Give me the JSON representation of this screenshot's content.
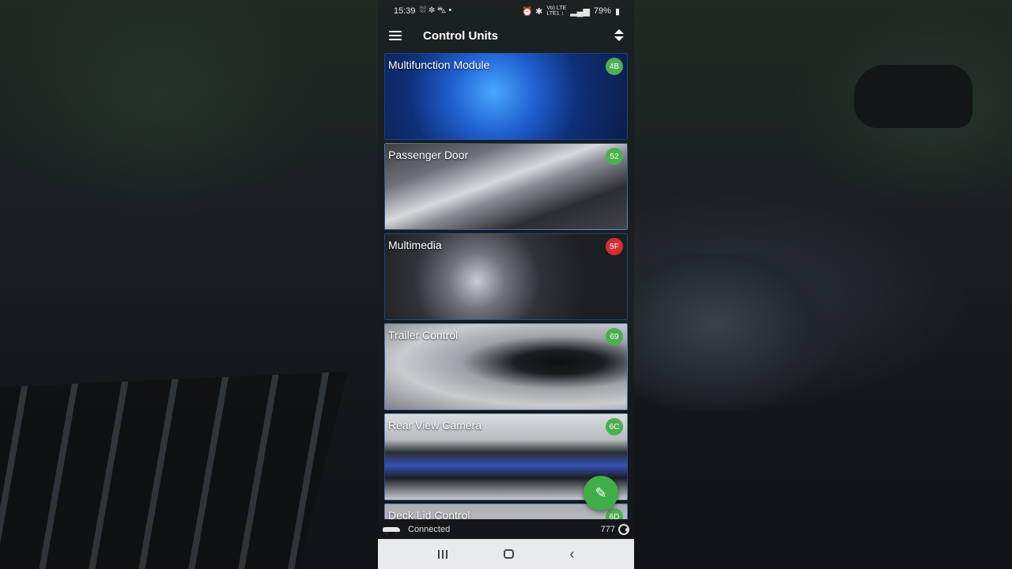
{
  "status_bar": {
    "time": "15:39",
    "left_icons": "⛆ ✽ ⛍ •",
    "right_icons": "⏰ ✱",
    "net_top": "Vo) LTE",
    "net_bottom": "LTE1 ↕",
    "battery": "79%"
  },
  "app_bar": {
    "title": "Control Units",
    "menu_icon": "menu-icon",
    "sort_icon": "sort-icon"
  },
  "units": [
    {
      "name": "Multifunction Module",
      "code": "4B",
      "status_color": "#4caf50",
      "bg": "bg-mfm"
    },
    {
      "name": "Passenger Door",
      "code": "52",
      "status_color": "#4caf50",
      "bg": "bg-door"
    },
    {
      "name": "Multimedia",
      "code": "5F",
      "status_color": "#d32f2f",
      "bg": "bg-mm"
    },
    {
      "name": "Trailer Control",
      "code": "69",
      "status_color": "#4caf50",
      "bg": "bg-trailer"
    },
    {
      "name": "Rear View Camera",
      "code": "6C",
      "status_color": "#4caf50",
      "bg": "bg-camera"
    },
    {
      "name": "Deck Lid Control",
      "code": "6D",
      "status_color": "#4caf50",
      "bg": "bg-decklid"
    }
  ],
  "fab": {
    "icon": "edit-pencil-icon",
    "color": "#3fae49"
  },
  "footer": {
    "connection": "Connected",
    "count": "777",
    "car_icon": "car-icon",
    "refresh_icon": "refresh-icon"
  },
  "nav": {
    "recent": "recent-apps-icon",
    "home": "home-icon",
    "back": "back-icon"
  }
}
